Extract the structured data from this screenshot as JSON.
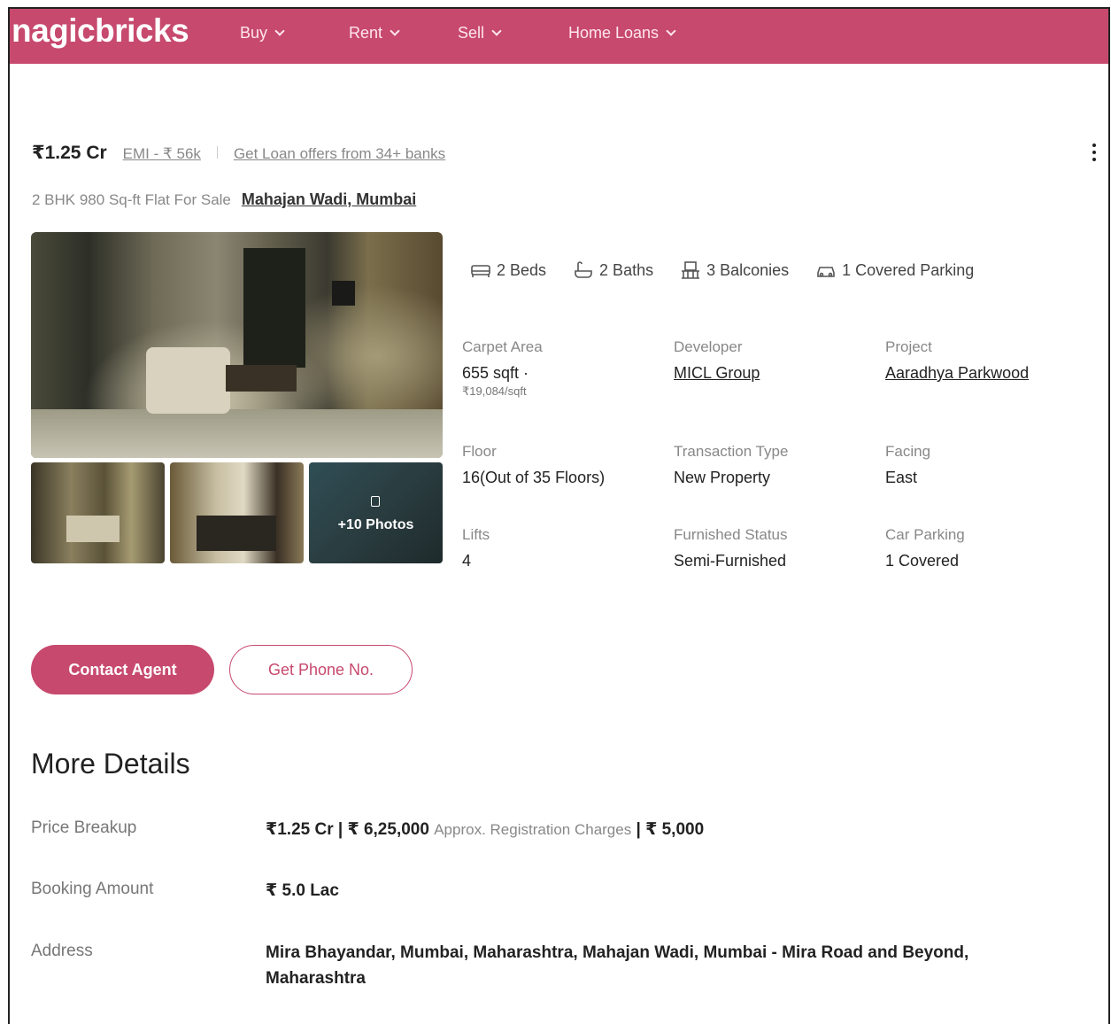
{
  "header": {
    "logo": "nagicbricks",
    "nav": [
      {
        "label": "Buy"
      },
      {
        "label": "Rent"
      },
      {
        "label": "Sell"
      },
      {
        "label": "Home Loans"
      }
    ]
  },
  "listing": {
    "price": "₹1.25 Cr",
    "emi": "EMI - ₹ 56k",
    "loan_offers": "Get Loan offers from 34+ banks",
    "subtitle": "2 BHK 980 Sq-ft Flat For Sale",
    "location": "Mahajan Wadi, Mumbai",
    "more_photos": "+10 Photos"
  },
  "amenities": {
    "beds": "2 Beds",
    "baths": "2 Baths",
    "balconies": "3 Balconies",
    "parking": "1 Covered Parking"
  },
  "specs": {
    "carpet_area": {
      "label": "Carpet Area",
      "value": "655 sqft ·",
      "sub": "₹19,084/sqft"
    },
    "developer": {
      "label": "Developer",
      "value": "MICL Group"
    },
    "project": {
      "label": "Project",
      "value": "Aaradhya Parkwood"
    },
    "floor": {
      "label": "Floor",
      "value": "16(Out of 35 Floors)"
    },
    "transaction_type": {
      "label": "Transaction Type",
      "value": "New Property"
    },
    "facing": {
      "label": "Facing",
      "value": "East"
    },
    "lifts": {
      "label": "Lifts",
      "value": "4"
    },
    "furnished_status": {
      "label": "Furnished Status",
      "value": "Semi-Furnished"
    },
    "car_parking": {
      "label": "Car Parking",
      "value": "1 Covered"
    }
  },
  "actions": {
    "contact_agent": "Contact Agent",
    "get_phone": "Get Phone No."
  },
  "more_details": {
    "title": "More Details",
    "price_breakup": {
      "label": "Price Breakup",
      "value": "₹1.25 Cr | ₹ 6,25,000",
      "muted": "Approx. Registration Charges",
      "tail": "| ₹ 5,000"
    },
    "booking_amount": {
      "label": "Booking Amount",
      "value": "₹ 5.0 Lac"
    },
    "address": {
      "label": "Address",
      "value": "Mira Bhayandar, Mumbai, Maharashtra, Mahajan Wadi, Mumbai - Mira Road and Beyond, Maharashtra"
    }
  },
  "colors": {
    "brand": "#c7496e",
    "text": "#222222",
    "muted": "#888888"
  }
}
